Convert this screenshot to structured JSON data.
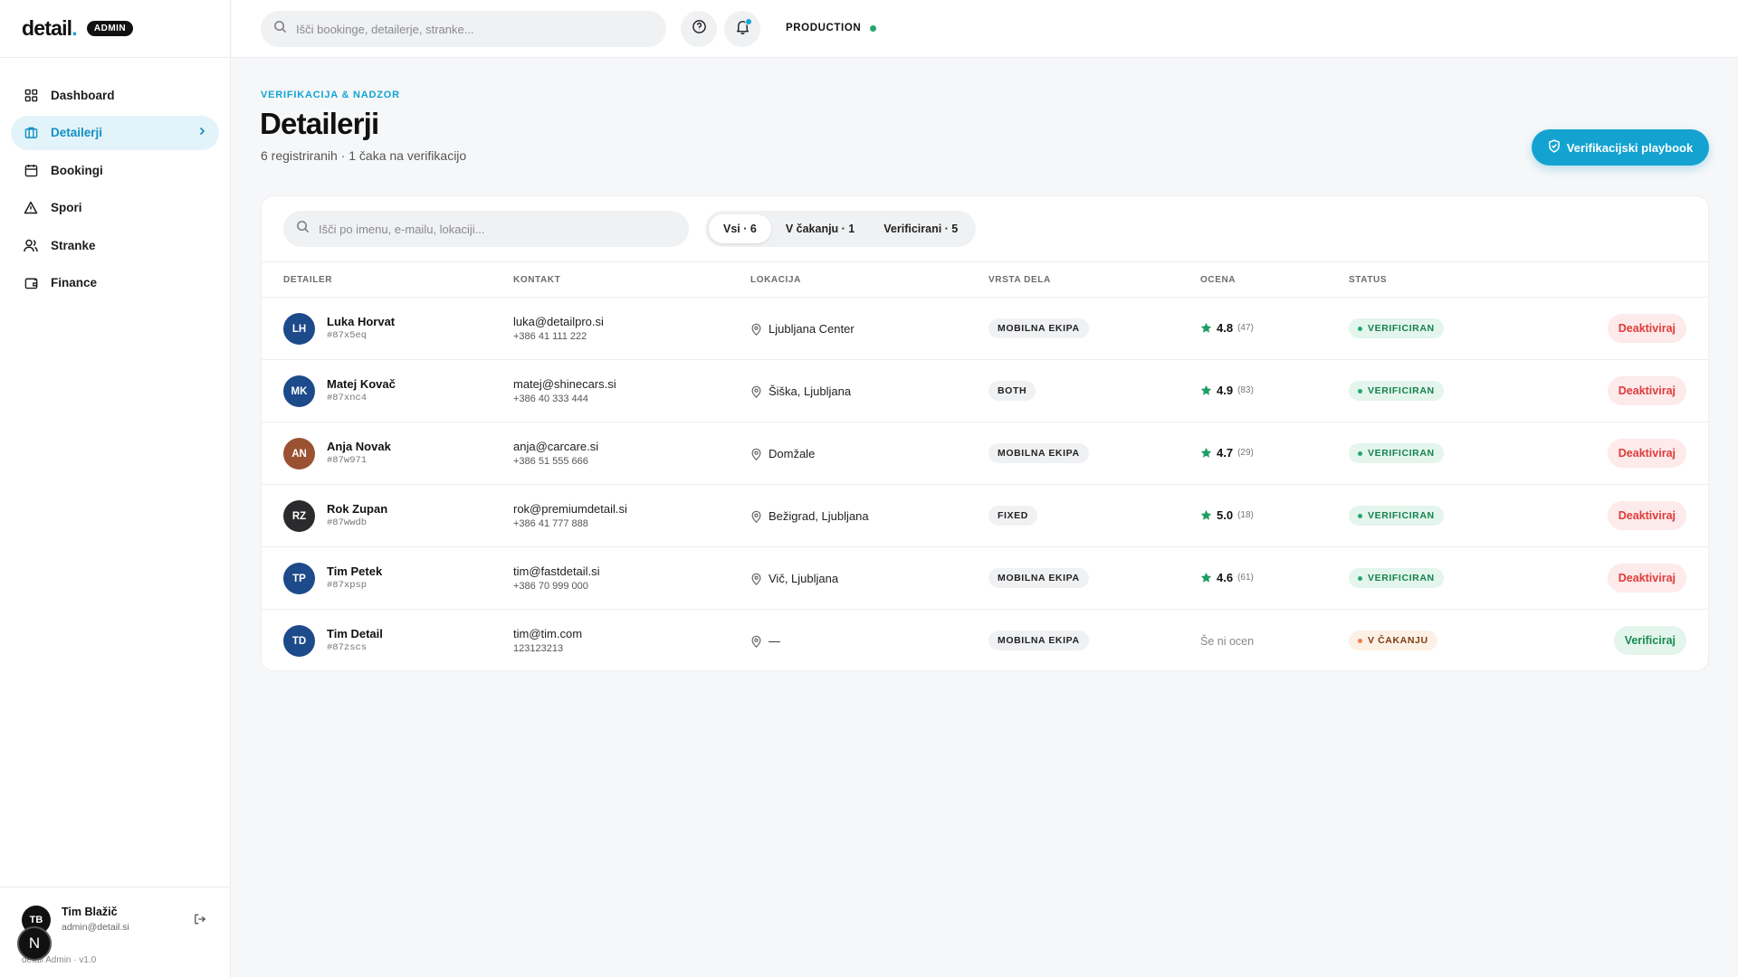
{
  "brand": {
    "logo": "detail",
    "badge": "ADMIN"
  },
  "sidebar": {
    "items": [
      {
        "label": "Dashboard",
        "icon": "grid-icon"
      },
      {
        "label": "Detailerji",
        "icon": "briefcase-icon"
      },
      {
        "label": "Bookingi",
        "icon": "calendar-icon"
      },
      {
        "label": "Spori",
        "icon": "warning-icon"
      },
      {
        "label": "Stranke",
        "icon": "users-icon"
      },
      {
        "label": "Finance",
        "icon": "wallet-icon"
      }
    ],
    "active_index": 1
  },
  "user": {
    "initials": "TB",
    "name": "Tim Blažič",
    "email": "admin@detail.si",
    "version": "detail Admin · v1.0",
    "n_badge": "N"
  },
  "topbar": {
    "search_placeholder": "Išči bookinge, detailerje, stranke...",
    "environment": "PRODUCTION"
  },
  "header": {
    "eyebrow": "VERIFIKACIJA & NADZOR",
    "title": "Detailerji",
    "subtitle": "6 registriranih · 1 čaka na verifikacijo",
    "playbook_button": "Verifikacijski playbook"
  },
  "table": {
    "search_placeholder": "Išči po imenu, e-mailu, lokaciji...",
    "filters": [
      "Vsi · 6",
      "V čakanju · 1",
      "Verificirani · 5"
    ],
    "active_filter": 0,
    "columns": [
      "DETAILER",
      "KONTAKT",
      "LOKACIJA",
      "VRSTA DELA",
      "OCENA",
      "STATUS"
    ],
    "rows": [
      {
        "initials": "LH",
        "avatar_color": "#1c4a8a",
        "name": "Luka Horvat",
        "code": "#87x5eq",
        "email": "luka@detailpro.si",
        "phone": "+386 41 111 222",
        "location": "Ljubljana Center",
        "type": "MOBILNA EKIPA",
        "rating": "4.8",
        "reviews": "(47)",
        "status": "VERIFICIRAN",
        "status_kind": "ok",
        "action": "Deaktiviraj",
        "action_kind": "danger"
      },
      {
        "initials": "MK",
        "avatar_color": "#1c4a8a",
        "name": "Matej Kovač",
        "code": "#87xnc4",
        "email": "matej@shinecars.si",
        "phone": "+386 40 333 444",
        "location": "Šiška, Ljubljana",
        "type": "BOTH",
        "rating": "4.9",
        "reviews": "(83)",
        "status": "VERIFICIRAN",
        "status_kind": "ok",
        "action": "Deaktiviraj",
        "action_kind": "danger"
      },
      {
        "initials": "AN",
        "avatar_color": "#9a5232",
        "name": "Anja Novak",
        "code": "#87w971",
        "email": "anja@carcare.si",
        "phone": "+386 51 555 666",
        "location": "Domžale",
        "type": "MOBILNA EKIPA",
        "rating": "4.7",
        "reviews": "(29)",
        "status": "VERIFICIRAN",
        "status_kind": "ok",
        "action": "Deaktiviraj",
        "action_kind": "danger"
      },
      {
        "initials": "RZ",
        "avatar_color": "#2b2b2e",
        "name": "Rok Zupan",
        "code": "#87wwdb",
        "email": "rok@premiumdetail.si",
        "phone": "+386 41 777 888",
        "location": "Bežigrad, Ljubljana",
        "type": "FIXED",
        "rating": "5.0",
        "reviews": "(18)",
        "status": "VERIFICIRAN",
        "status_kind": "ok",
        "action": "Deaktiviraj",
        "action_kind": "danger"
      },
      {
        "initials": "TP",
        "avatar_color": "#1c4a8a",
        "name": "Tim Petek",
        "code": "#87xpsp",
        "email": "tim@fastdetail.si",
        "phone": "+386 70 999 000",
        "location": "Vič, Ljubljana",
        "type": "MOBILNA EKIPA",
        "rating": "4.6",
        "reviews": "(61)",
        "status": "VERIFICIRAN",
        "status_kind": "ok",
        "action": "Deaktiviraj",
        "action_kind": "danger"
      },
      {
        "initials": "TD",
        "avatar_color": "#1c4a8a",
        "name": "Tim Detail",
        "code": "#87zscs",
        "email": "tim@tim.com",
        "phone": "123123213",
        "location": "—",
        "type": "MOBILNA EKIPA",
        "rating": "",
        "reviews": "",
        "no_rating": "Še ni ocen",
        "status": "V ČAKANJU",
        "status_kind": "wait",
        "action": "Verificiraj",
        "action_kind": "verify"
      }
    ]
  },
  "colors": {
    "accent": "#10a5d5",
    "success": "#22a870",
    "danger": "#e03b3b",
    "warning": "#f07a55"
  }
}
